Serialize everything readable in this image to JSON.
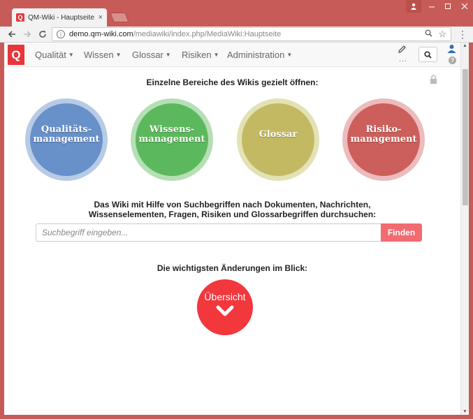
{
  "browser": {
    "tab_title": "QM-Wiki - Hauptseite – ",
    "tab_close": "×",
    "favicon_letter": "Q",
    "url_host": "demo.qm-wiki.com",
    "url_path": "/mediawiki/index.php/MediaWiki:Hauptseite"
  },
  "sitenav": {
    "logo_letter": "Q",
    "items": [
      {
        "label": "Qualität"
      },
      {
        "label": "Wissen"
      },
      {
        "label": "Glossar"
      },
      {
        "label": "Risiken"
      },
      {
        "label": "Administration"
      }
    ],
    "more": "...",
    "help": "?"
  },
  "main": {
    "heading_areas": "Einzelne Bereiche des Wikis gezielt öffnen:",
    "areas": [
      {
        "line1": "Qualitäts-",
        "line2": "management",
        "color": "#6890c9"
      },
      {
        "line1": "Wissens-",
        "line2": "management",
        "color": "#5cb85c"
      },
      {
        "line1": "Glossar",
        "line2": "",
        "color": "#c4b963"
      },
      {
        "line1": "Risiko-",
        "line2": "management",
        "color": "#cc5f5b"
      }
    ],
    "heading_search_line1": "Das Wiki mit Hilfe von Suchbegriffen nach Dokumenten, Nachrichten,",
    "heading_search_line2": "Wissenselementen, Fragen, Risiken und Glossarbegriffen durchsuchen:",
    "search_placeholder": "Suchbegriff eingeben...",
    "search_value": "",
    "find_label": "Finden",
    "heading_changes": "Die wichtigsten Änderungen im Blick:",
    "overview_label": "Übersicht"
  },
  "colors": {
    "accent": "#f2373d",
    "find_button": "#f26b70",
    "window_frame": "#c75b57"
  }
}
